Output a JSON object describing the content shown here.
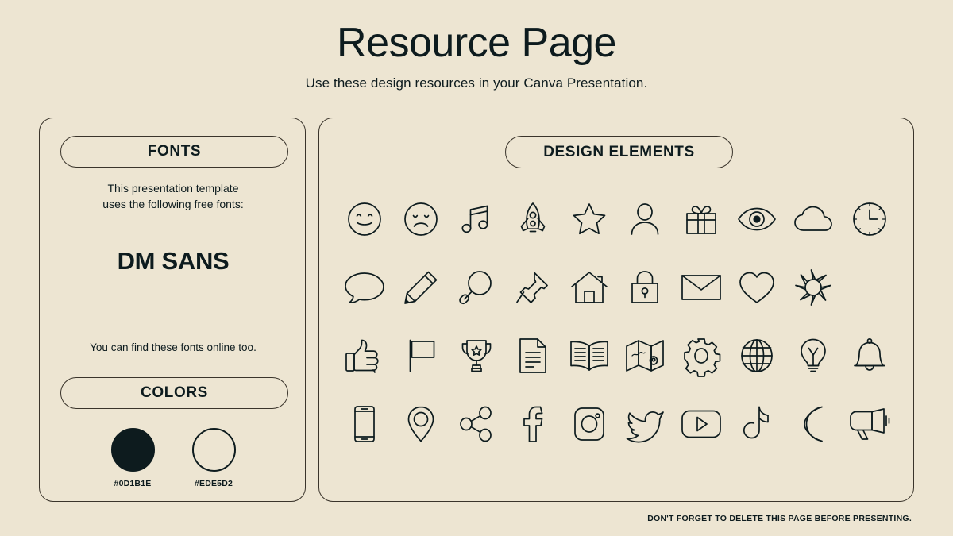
{
  "header": {
    "title": "Resource Page",
    "subtitle": "Use these design resources in your Canva Presentation."
  },
  "fonts_panel": {
    "heading": "FONTS",
    "intro": "This presentation template\nuses the following free fonts:",
    "font_name": "DM SANS",
    "note": "You can find these fonts online too."
  },
  "colors_panel": {
    "heading": "COLORS",
    "swatches": [
      {
        "name": "dark-swatch",
        "hex": "#0D1B1E",
        "label": "#0D1B1E"
      },
      {
        "name": "light-swatch",
        "hex": "#EDE5D2",
        "label": "#EDE5D2"
      }
    ]
  },
  "elements_panel": {
    "heading": "DESIGN ELEMENTS",
    "rows": [
      [
        "smiley-face-icon",
        "sad-face-icon",
        "music-note-icon",
        "rocket-icon",
        "star-icon",
        "person-icon",
        "gift-icon",
        "eye-icon",
        "cloud-icon",
        "clock-icon"
      ],
      [
        "speech-bubble-icon",
        "pencil-icon",
        "magnifier-icon",
        "pushpin-icon",
        "house-icon",
        "lock-icon",
        "envelope-icon",
        "heart-icon",
        "sun-icon"
      ],
      [
        "thumbs-up-icon",
        "flag-icon",
        "trophy-icon",
        "document-icon",
        "book-icon",
        "map-icon",
        "gear-icon",
        "globe-icon",
        "lightbulb-icon",
        "bell-icon"
      ],
      [
        "phone-icon",
        "location-pin-icon",
        "share-icon",
        "facebook-icon",
        "instagram-icon",
        "twitter-icon",
        "youtube-icon",
        "tiktok-icon",
        "moon-icon",
        "megaphone-icon"
      ]
    ]
  },
  "footer": {
    "note": "DON'T FORGET TO DELETE THIS PAGE BEFORE PRESENTING."
  },
  "theme": {
    "background": "#EDE5D2",
    "ink": "#0D1B1E",
    "border": "#3A342B"
  }
}
